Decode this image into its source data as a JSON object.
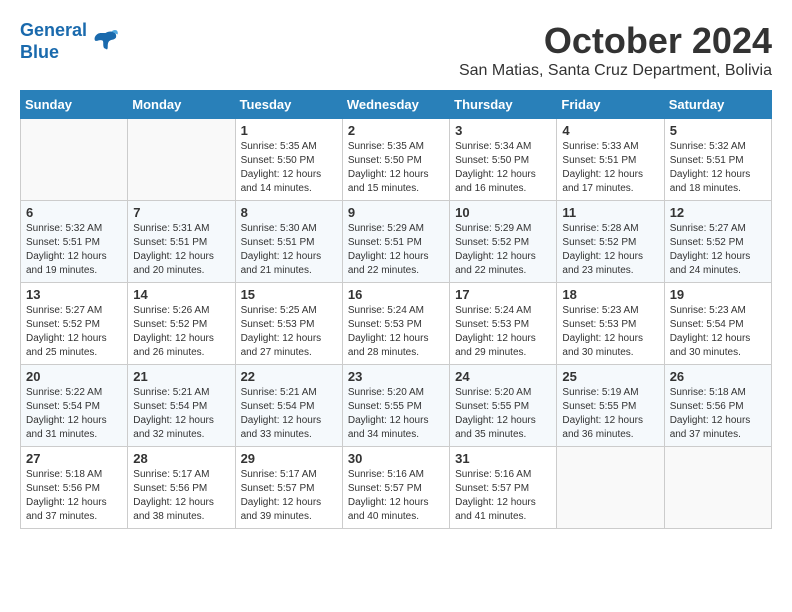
{
  "logo": {
    "line1": "General",
    "line2": "Blue"
  },
  "title": "October 2024",
  "location": "San Matias, Santa Cruz Department, Bolivia",
  "headers": [
    "Sunday",
    "Monday",
    "Tuesday",
    "Wednesday",
    "Thursday",
    "Friday",
    "Saturday"
  ],
  "weeks": [
    [
      {
        "day": "",
        "sunrise": "",
        "sunset": "",
        "daylight": ""
      },
      {
        "day": "",
        "sunrise": "",
        "sunset": "",
        "daylight": ""
      },
      {
        "day": "1",
        "sunrise": "Sunrise: 5:35 AM",
        "sunset": "Sunset: 5:50 PM",
        "daylight": "Daylight: 12 hours and 14 minutes."
      },
      {
        "day": "2",
        "sunrise": "Sunrise: 5:35 AM",
        "sunset": "Sunset: 5:50 PM",
        "daylight": "Daylight: 12 hours and 15 minutes."
      },
      {
        "day": "3",
        "sunrise": "Sunrise: 5:34 AM",
        "sunset": "Sunset: 5:50 PM",
        "daylight": "Daylight: 12 hours and 16 minutes."
      },
      {
        "day": "4",
        "sunrise": "Sunrise: 5:33 AM",
        "sunset": "Sunset: 5:51 PM",
        "daylight": "Daylight: 12 hours and 17 minutes."
      },
      {
        "day": "5",
        "sunrise": "Sunrise: 5:32 AM",
        "sunset": "Sunset: 5:51 PM",
        "daylight": "Daylight: 12 hours and 18 minutes."
      }
    ],
    [
      {
        "day": "6",
        "sunrise": "Sunrise: 5:32 AM",
        "sunset": "Sunset: 5:51 PM",
        "daylight": "Daylight: 12 hours and 19 minutes."
      },
      {
        "day": "7",
        "sunrise": "Sunrise: 5:31 AM",
        "sunset": "Sunset: 5:51 PM",
        "daylight": "Daylight: 12 hours and 20 minutes."
      },
      {
        "day": "8",
        "sunrise": "Sunrise: 5:30 AM",
        "sunset": "Sunset: 5:51 PM",
        "daylight": "Daylight: 12 hours and 21 minutes."
      },
      {
        "day": "9",
        "sunrise": "Sunrise: 5:29 AM",
        "sunset": "Sunset: 5:51 PM",
        "daylight": "Daylight: 12 hours and 22 minutes."
      },
      {
        "day": "10",
        "sunrise": "Sunrise: 5:29 AM",
        "sunset": "Sunset: 5:52 PM",
        "daylight": "Daylight: 12 hours and 22 minutes."
      },
      {
        "day": "11",
        "sunrise": "Sunrise: 5:28 AM",
        "sunset": "Sunset: 5:52 PM",
        "daylight": "Daylight: 12 hours and 23 minutes."
      },
      {
        "day": "12",
        "sunrise": "Sunrise: 5:27 AM",
        "sunset": "Sunset: 5:52 PM",
        "daylight": "Daylight: 12 hours and 24 minutes."
      }
    ],
    [
      {
        "day": "13",
        "sunrise": "Sunrise: 5:27 AM",
        "sunset": "Sunset: 5:52 PM",
        "daylight": "Daylight: 12 hours and 25 minutes."
      },
      {
        "day": "14",
        "sunrise": "Sunrise: 5:26 AM",
        "sunset": "Sunset: 5:52 PM",
        "daylight": "Daylight: 12 hours and 26 minutes."
      },
      {
        "day": "15",
        "sunrise": "Sunrise: 5:25 AM",
        "sunset": "Sunset: 5:53 PM",
        "daylight": "Daylight: 12 hours and 27 minutes."
      },
      {
        "day": "16",
        "sunrise": "Sunrise: 5:24 AM",
        "sunset": "Sunset: 5:53 PM",
        "daylight": "Daylight: 12 hours and 28 minutes."
      },
      {
        "day": "17",
        "sunrise": "Sunrise: 5:24 AM",
        "sunset": "Sunset: 5:53 PM",
        "daylight": "Daylight: 12 hours and 29 minutes."
      },
      {
        "day": "18",
        "sunrise": "Sunrise: 5:23 AM",
        "sunset": "Sunset: 5:53 PM",
        "daylight": "Daylight: 12 hours and 30 minutes."
      },
      {
        "day": "19",
        "sunrise": "Sunrise: 5:23 AM",
        "sunset": "Sunset: 5:54 PM",
        "daylight": "Daylight: 12 hours and 30 minutes."
      }
    ],
    [
      {
        "day": "20",
        "sunrise": "Sunrise: 5:22 AM",
        "sunset": "Sunset: 5:54 PM",
        "daylight": "Daylight: 12 hours and 31 minutes."
      },
      {
        "day": "21",
        "sunrise": "Sunrise: 5:21 AM",
        "sunset": "Sunset: 5:54 PM",
        "daylight": "Daylight: 12 hours and 32 minutes."
      },
      {
        "day": "22",
        "sunrise": "Sunrise: 5:21 AM",
        "sunset": "Sunset: 5:54 PM",
        "daylight": "Daylight: 12 hours and 33 minutes."
      },
      {
        "day": "23",
        "sunrise": "Sunrise: 5:20 AM",
        "sunset": "Sunset: 5:55 PM",
        "daylight": "Daylight: 12 hours and 34 minutes."
      },
      {
        "day": "24",
        "sunrise": "Sunrise: 5:20 AM",
        "sunset": "Sunset: 5:55 PM",
        "daylight": "Daylight: 12 hours and 35 minutes."
      },
      {
        "day": "25",
        "sunrise": "Sunrise: 5:19 AM",
        "sunset": "Sunset: 5:55 PM",
        "daylight": "Daylight: 12 hours and 36 minutes."
      },
      {
        "day": "26",
        "sunrise": "Sunrise: 5:18 AM",
        "sunset": "Sunset: 5:56 PM",
        "daylight": "Daylight: 12 hours and 37 minutes."
      }
    ],
    [
      {
        "day": "27",
        "sunrise": "Sunrise: 5:18 AM",
        "sunset": "Sunset: 5:56 PM",
        "daylight": "Daylight: 12 hours and 37 minutes."
      },
      {
        "day": "28",
        "sunrise": "Sunrise: 5:17 AM",
        "sunset": "Sunset: 5:56 PM",
        "daylight": "Daylight: 12 hours and 38 minutes."
      },
      {
        "day": "29",
        "sunrise": "Sunrise: 5:17 AM",
        "sunset": "Sunset: 5:57 PM",
        "daylight": "Daylight: 12 hours and 39 minutes."
      },
      {
        "day": "30",
        "sunrise": "Sunrise: 5:16 AM",
        "sunset": "Sunset: 5:57 PM",
        "daylight": "Daylight: 12 hours and 40 minutes."
      },
      {
        "day": "31",
        "sunrise": "Sunrise: 5:16 AM",
        "sunset": "Sunset: 5:57 PM",
        "daylight": "Daylight: 12 hours and 41 minutes."
      },
      {
        "day": "",
        "sunrise": "",
        "sunset": "",
        "daylight": ""
      },
      {
        "day": "",
        "sunrise": "",
        "sunset": "",
        "daylight": ""
      }
    ]
  ]
}
